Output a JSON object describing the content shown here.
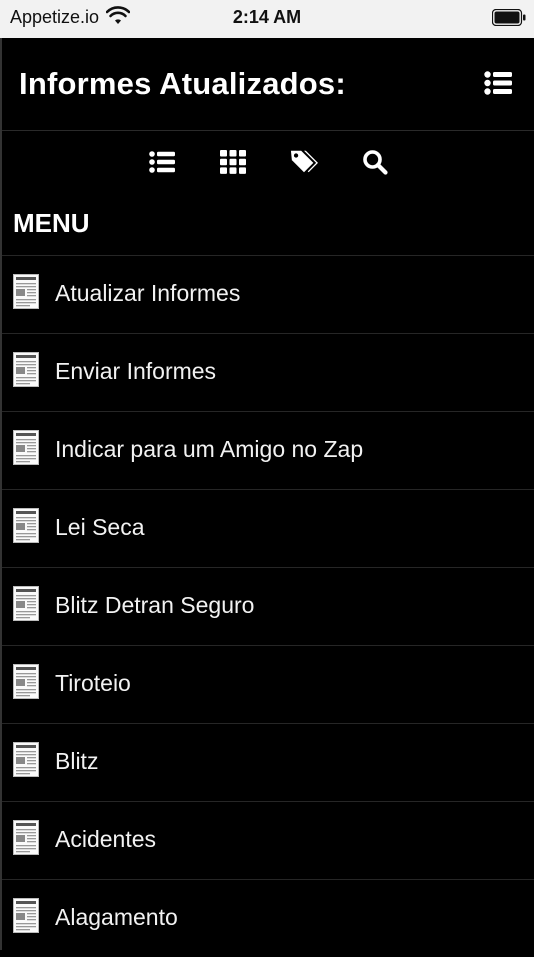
{
  "status": {
    "carrier": "Appetize.io",
    "time": "2:14 AM"
  },
  "header": {
    "title": "Informes Atualizados:",
    "menu_icon": "list-icon"
  },
  "toolbar": {
    "icons": [
      "list-icon",
      "grid-icon",
      "tags-icon",
      "search-icon"
    ]
  },
  "menu": {
    "title": "MENU",
    "items": [
      {
        "label": "Atualizar Informes"
      },
      {
        "label": "Enviar Informes"
      },
      {
        "label": "Indicar para um Amigo no Zap"
      },
      {
        "label": "Lei Seca"
      },
      {
        "label": "Blitz Detran Seguro"
      },
      {
        "label": "Tiroteio"
      },
      {
        "label": "Blitz"
      },
      {
        "label": "Acidentes"
      },
      {
        "label": "Alagamento"
      }
    ]
  },
  "colors": {
    "background": "#000000",
    "text": "#ffffff",
    "status_bar": "#f2f2f2"
  }
}
